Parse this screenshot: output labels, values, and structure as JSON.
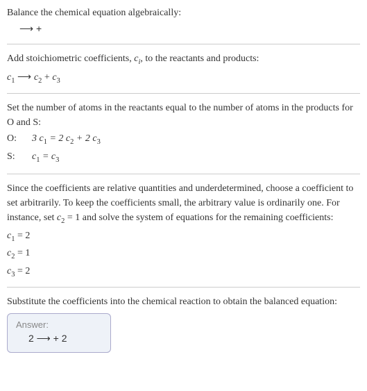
{
  "section1": {
    "title": "Balance the chemical equation algebraically:",
    "reaction": " ⟶  + "
  },
  "section2": {
    "intro_a": "Add stoichiometric coefficients, ",
    "intro_var": "c",
    "intro_sub": "i",
    "intro_b": ", to the reactants and products:",
    "reaction_parts": {
      "c1": "c",
      "s1": "1",
      "arrow": " ⟶ ",
      "c2": "c",
      "s2": "2",
      "plus": " + ",
      "c3": "c",
      "s3": "3"
    }
  },
  "section3": {
    "intro": "Set the number of atoms in the reactants equal to the number of atoms in the products for O and S:",
    "rowO_label": "O: ",
    "rowO_eq_a": "3 c",
    "rowO_eq_s1": "1",
    "rowO_eq_b": " = 2 c",
    "rowO_eq_s2": "2",
    "rowO_eq_c": " + 2 c",
    "rowO_eq_s3": "3",
    "rowS_label": "S: ",
    "rowS_eq_a": "c",
    "rowS_eq_s1": "1",
    "rowS_eq_b": " = c",
    "rowS_eq_s3": "3"
  },
  "section4": {
    "text_a": "Since the coefficients are relative quantities and underdetermined, choose a coefficient to set arbitrarily. To keep the coefficients small, the arbitrary value is ordinarily one. For instance, set ",
    "var": "c",
    "varsub": "2",
    "text_b": " = 1 and solve the system of equations for the remaining coefficients:",
    "eq1_a": "c",
    "eq1_s": "1",
    "eq1_b": " = 2",
    "eq2_a": "c",
    "eq2_s": "2",
    "eq2_b": " = 1",
    "eq3_a": "c",
    "eq3_s": "3",
    "eq3_b": " = 2"
  },
  "section5": {
    "intro": "Substitute the coefficients into the chemical reaction to obtain the balanced equation:",
    "answer_label": "Answer:",
    "answer_eq": "2  ⟶  + 2 "
  }
}
